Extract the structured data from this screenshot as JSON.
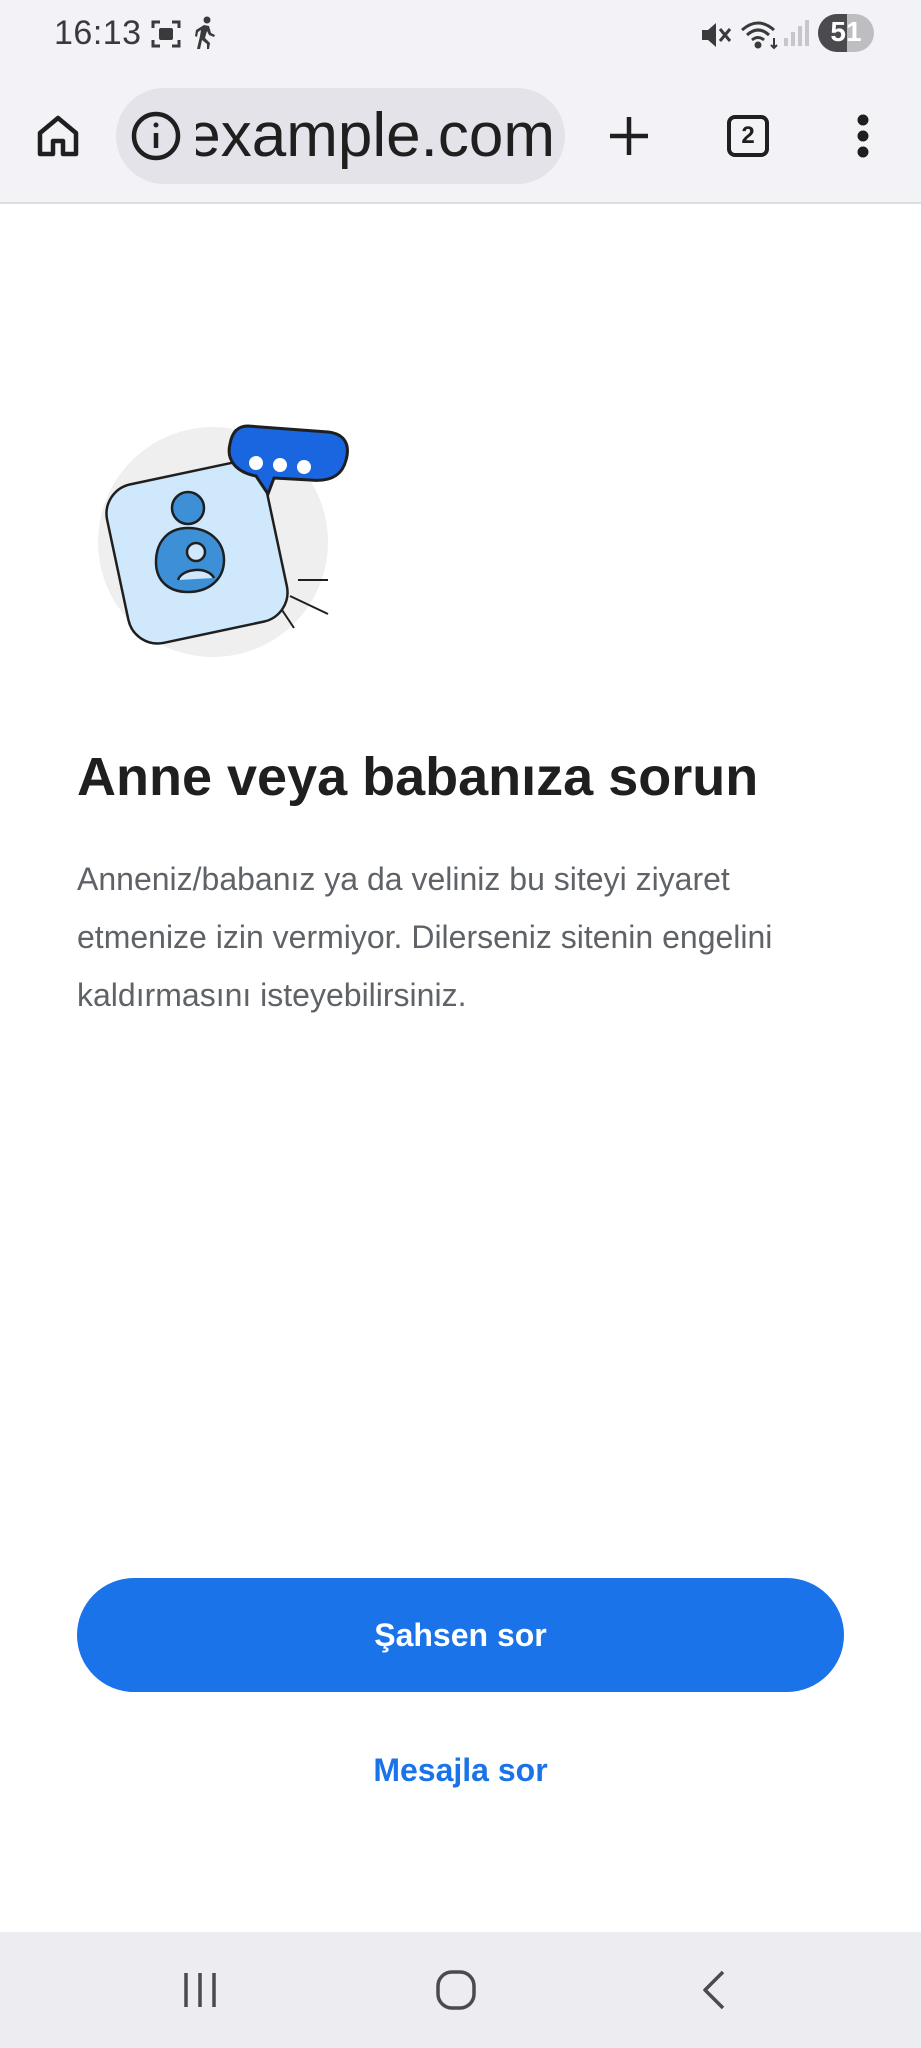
{
  "status_bar": {
    "time": "16:13",
    "battery_level": "51",
    "battery_fraction": 0.51,
    "icons": [
      "screenshot-icon",
      "walking-icon",
      "mute-icon",
      "wifi-icon",
      "signal-icon",
      "battery-icon"
    ]
  },
  "browser": {
    "url": "example.com",
    "tab_count": "2",
    "icons": [
      "home-icon",
      "info-icon",
      "new-tab-icon",
      "tab-switcher-icon",
      "more-menu-icon"
    ]
  },
  "content": {
    "title": "Anne veya babanıza sorun",
    "description": "Anneniz/babanız ya da veliniz bu siteyi ziyaret etmenize izin vermiyor. Dilerseniz sitenin engelini kaldırmasını isteyebilirsiniz.",
    "primary_button": "Şahsen sor",
    "secondary_button": "Mesajla sor"
  },
  "nav_bar": {
    "icons": [
      "recent-apps-icon",
      "home-nav-icon",
      "back-icon"
    ]
  },
  "colors": {
    "accent": "#1a73e8",
    "bubble": "#1a66e0",
    "card": "#cfe8fb"
  }
}
